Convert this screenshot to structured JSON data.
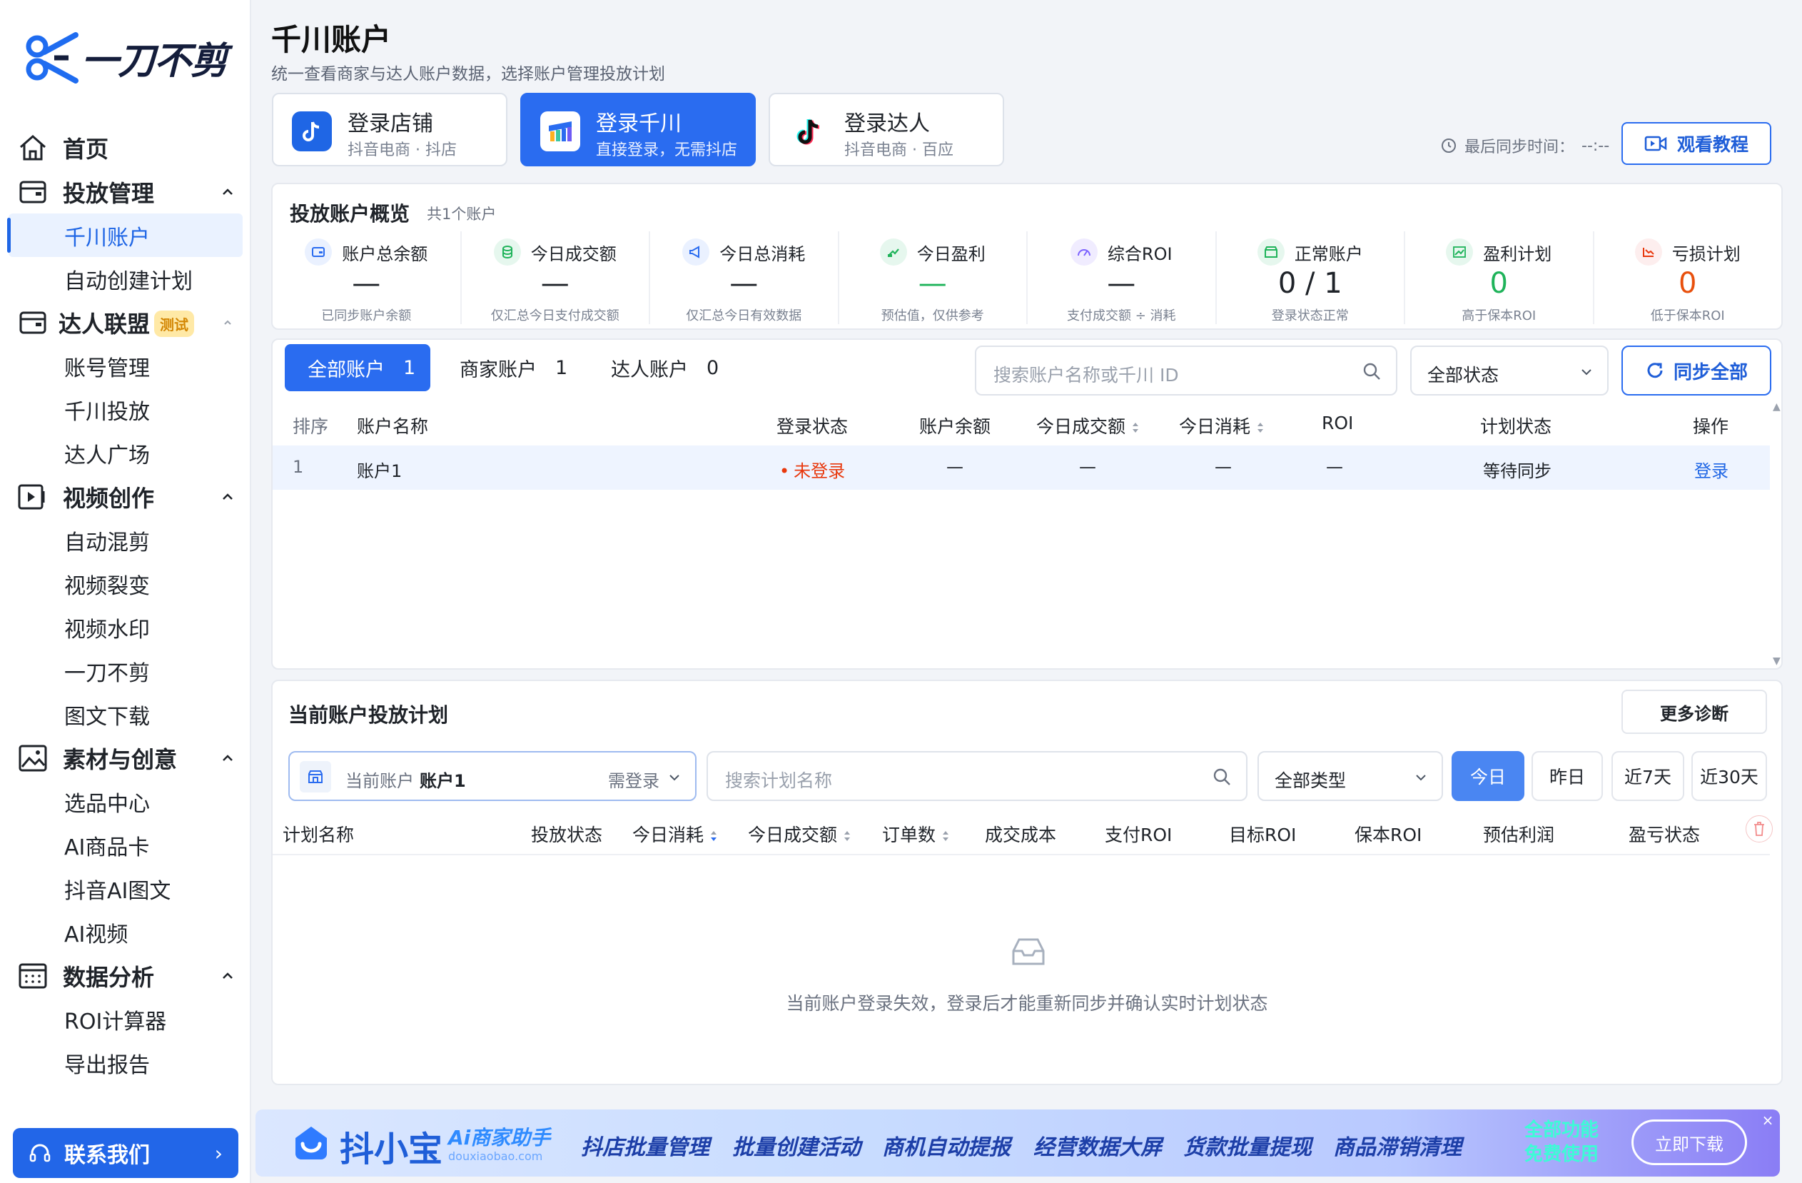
{
  "logo": {
    "text": "一刀不剪"
  },
  "sidebar": {
    "home": "首页",
    "groups": [
      {
        "label": "投放管理",
        "items": [
          "千川账户",
          "自动创建计划"
        ]
      },
      {
        "label": "达人联盟",
        "badge": "测试",
        "items": [
          "账号管理",
          "千川投放",
          "达人广场"
        ]
      },
      {
        "label": "视频创作",
        "items": [
          "自动混剪",
          "视频裂变",
          "视频水印",
          "一刀不剪",
          "图文下载"
        ]
      },
      {
        "label": "素材与创意",
        "items": [
          "选品中心",
          "AI商品卡",
          "抖音AI图文",
          "AI视频"
        ]
      },
      {
        "label": "数据分析",
        "items": [
          "ROI计算器",
          "导出报告"
        ]
      }
    ],
    "active_item": "千川账户",
    "contact": "联系我们"
  },
  "header": {
    "title": "千川账户",
    "subtitle": "统一查看商家与达人账户数据，选择账户管理投放计划",
    "login_cards": [
      {
        "title": "登录店铺",
        "sub": "抖音电商 · 抖店"
      },
      {
        "title": "登录千川",
        "sub": "直接登录，无需抖店"
      },
      {
        "title": "登录达人",
        "sub": "抖音电商 · 百应"
      }
    ],
    "sync_time_label": "最后同步时间：",
    "sync_time_value": "--:--",
    "watch_button": "观看教程"
  },
  "overview": {
    "title": "投放账户概览",
    "count": "共1个账户",
    "metrics": [
      {
        "label": "账户总余额",
        "value": "—",
        "sub": "已同步账户余额",
        "color": "#1f2329"
      },
      {
        "label": "今日成交额",
        "value": "—",
        "sub": "仅汇总今日支付成交额",
        "color": "#1f2329"
      },
      {
        "label": "今日总消耗",
        "value": "—",
        "sub": "仅汇总今日有效数据",
        "color": "#1f2329"
      },
      {
        "label": "今日盈利",
        "value": "—",
        "sub": "预估值，仅供参考",
        "color": "#1fb35a"
      },
      {
        "label": "综合ROI",
        "value": "—",
        "sub": "支付成交额 ÷ 消耗",
        "color": "#1f2329"
      },
      {
        "label": "正常账户",
        "value": "0 / 1",
        "sub": "登录状态正常",
        "color": "#1f2329"
      },
      {
        "label": "盈利计划",
        "value": "0",
        "sub": "高于保本ROI",
        "color": "#1fb35a"
      },
      {
        "label": "亏损计划",
        "value": "0",
        "sub": "低于保本ROI",
        "color": "#e8500d"
      }
    ]
  },
  "accounts": {
    "tabs": [
      {
        "label": "全部账户",
        "count": "1"
      },
      {
        "label": "商家账户",
        "count": "1"
      },
      {
        "label": "达人账户",
        "count": "0"
      }
    ],
    "search_placeholder": "搜索账户名称或千川 ID",
    "status_select": "全部状态",
    "sync_all": "同步全部",
    "columns": [
      "排序",
      "账户名称",
      "登录状态",
      "账户余额",
      "今日成交额",
      "今日消耗",
      "ROI",
      "计划状态",
      "操作"
    ],
    "rows": [
      {
        "index": "1",
        "name": "账户1",
        "login": "未登录",
        "balance": "—",
        "gmv": "—",
        "cost": "—",
        "roi": "—",
        "plan_status": "等待同步",
        "action": "登录"
      }
    ]
  },
  "plans": {
    "title": "当前账户投放计划",
    "more_diag": "更多诊断",
    "account_prefix": "当前账户",
    "account_name": "账户1",
    "account_need": "需登录",
    "search_placeholder": "搜索计划名称",
    "type_select": "全部类型",
    "day_buttons": [
      "今日",
      "昨日",
      "近7天",
      "近30天"
    ],
    "columns": [
      "计划名称",
      "投放状态",
      "今日消耗",
      "今日成交额",
      "订单数",
      "成交成本",
      "支付ROI",
      "目标ROI",
      "保本ROI",
      "预估利润",
      "盈亏状态"
    ],
    "empty_text": "当前账户登录失效，登录后才能重新同步并确认实时计划状态"
  },
  "banner": {
    "brand": "抖小宝",
    "sub": "Ai商家助手",
    "site": "douxiaobao.com",
    "features": [
      "抖店批量管理",
      "批量创建活动",
      "商机自动提报",
      "经营数据大屏",
      "货款批量提现",
      "商品滞销清理"
    ],
    "free_line1": "全部功能",
    "free_line2": "免费使用",
    "download": "立即下载",
    "close": "×"
  }
}
